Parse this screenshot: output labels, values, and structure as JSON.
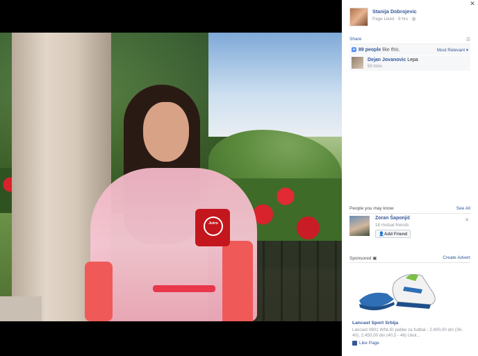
{
  "photo": {
    "mug_text": "Jutro"
  },
  "post": {
    "author": "Stanija Dobrojevic",
    "meta": "Page Liked · 8 hrs · ",
    "audience_icon": "globe-icon",
    "share_label": "Share",
    "menu_icon": "list-icon"
  },
  "likes": {
    "count": "89 people",
    "suffix": " like this.",
    "sort_label": "Most Relevant ▾"
  },
  "comment": {
    "author": "Dejan Jovanovic",
    "text": " Lepa",
    "time": "50 mins"
  },
  "pymk": {
    "title": "People you may know",
    "see_all": "See All",
    "person": {
      "name": "Zoran Šaponjić",
      "mutual": "18 mutual friends",
      "add_label": "Add Friend"
    }
  },
  "sponsored": {
    "title": "Sponsored",
    "create_label": "Create Advert",
    "ad_title": "Lancast Sport Srbija",
    "ad_desc": "Lancast 0801 WNLID patike za fudbal - 2.400,00 din (36-40), 2.450,00 din (40,5 - 46) Ukol...",
    "like_label": "Like Page"
  },
  "colors": {
    "link": "#365899",
    "muted": "#90949c",
    "background": "#000000",
    "sidebar": "#ffffff"
  }
}
